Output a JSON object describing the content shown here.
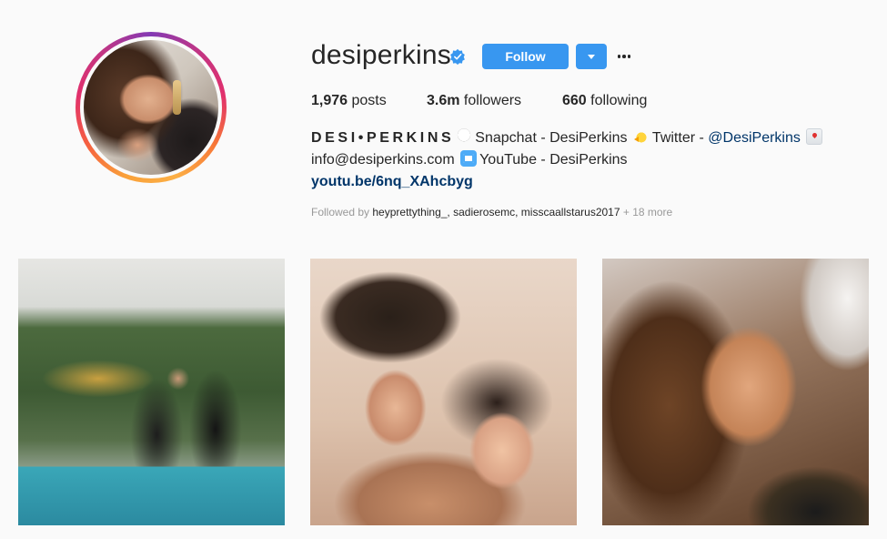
{
  "profile": {
    "username": "desiperkins",
    "verified": true,
    "follow_label": "Follow",
    "stats": {
      "posts_count": "1,976",
      "posts_label": " posts",
      "followers_count": "3.6m",
      "followers_label": " followers",
      "following_count": "660",
      "following_label": " following"
    },
    "bio": {
      "name": "DESI•PERKINS",
      "snapchat": "Snapchat - DesiPerkins",
      "twitter_prefix": "Twitter - ",
      "twitter_handle": "@DesiPerkins",
      "email": "info@desiperkins.com",
      "youtube": "YouTube - DesiPerkins",
      "link": "youtu.be/6nq_XAhcbyg"
    },
    "followed_by": {
      "prefix": "Followed by ",
      "names": "heyprettything_, sadierosemc, misscaallstarus2017",
      "more": " + 18 more"
    }
  },
  "icons": {
    "verified": "verified-badge-icon",
    "dropdown": "chevron-down-icon",
    "more": "more-options-icon",
    "snapchat_emoji": "ghost-icon",
    "twitter_emoji": "chick-icon",
    "email_emoji": "love-letter-icon",
    "youtube_emoji": "film-frames-icon"
  },
  "colors": {
    "primary_button": "#3897f0",
    "link": "#003569",
    "muted_text": "#999999",
    "verified_blue": "#3897f0"
  },
  "posts": [
    {
      "label": "post-1"
    },
    {
      "label": "post-2"
    },
    {
      "label": "post-3"
    }
  ]
}
